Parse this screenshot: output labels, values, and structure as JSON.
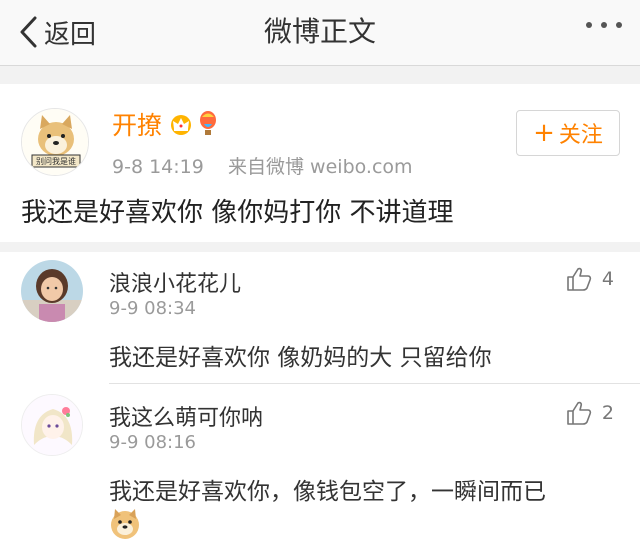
{
  "nav": {
    "back_label": "返回",
    "title": "微博正文"
  },
  "post": {
    "user_name": "开撩",
    "time": "9-8 14:19",
    "source": "来自微博 weibo.com",
    "follow_label": "关注",
    "text": "我还是好喜欢你 像你妈打你 不讲道理",
    "avatar_sign": "别问我是谁",
    "badges": [
      "crown-icon",
      "balloon-icon"
    ]
  },
  "comments": [
    {
      "name": "浪浪小花花儿",
      "time": "9-9 08:34",
      "likes": "4",
      "text": "我还是好喜欢你 像奶妈的大 只留给你"
    },
    {
      "name": "我这么萌可你呐",
      "time": "9-9 08:16",
      "likes": "2",
      "text": "我还是好喜欢你，像钱包空了，一瞬间而已",
      "emoji": "doge-emoji"
    }
  ],
  "colors": {
    "accent": "#ff8200",
    "background": "#f2f2f2",
    "text": "#333333",
    "muted": "#9a9a9a"
  }
}
